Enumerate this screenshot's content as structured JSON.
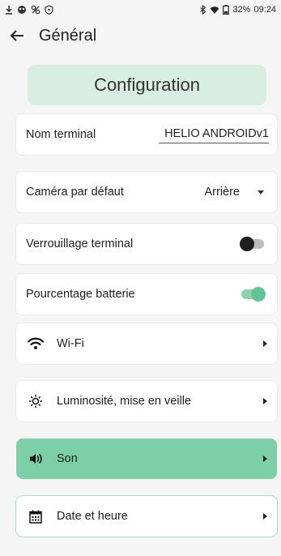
{
  "status_bar": {
    "left_icons": [
      "download-icon",
      "app-notification-icon",
      "link-icon",
      "shield-icon"
    ],
    "right_icons": [
      "bluetooth-icon",
      "wifi-signal-icon",
      "battery-icon"
    ],
    "battery": "32%",
    "time": "09:24"
  },
  "app_bar": {
    "title": "Général",
    "back_icon": "arrow-back-icon"
  },
  "header": {
    "title": "Configuration",
    "bg_color": "#d8eee3"
  },
  "settings": {
    "terminal_name": {
      "label": "Nom terminal",
      "value": "HELIO ANDROIDv1"
    },
    "default_camera": {
      "label": "Caméra par défaut",
      "value": "Arrière"
    },
    "terminal_lock": {
      "label": "Verrouillage terminal",
      "enabled": false
    },
    "battery_percentage": {
      "label": "Pourcentage batterie",
      "enabled": true
    }
  },
  "nav": {
    "wifi": {
      "label": "Wi-Fi",
      "icon": "wifi-icon"
    },
    "brightness": {
      "label": "Luminosité, mise en veille",
      "icon": "brightness-icon"
    },
    "sound": {
      "label": "Son",
      "icon": "speaker-icon",
      "active": true
    },
    "datetime": {
      "label": "Date et heure",
      "icon": "calendar-icon"
    }
  },
  "colors": {
    "accent": "#5fc596",
    "active_row": "#7ccfa7",
    "header_bg": "#d8eee3"
  }
}
